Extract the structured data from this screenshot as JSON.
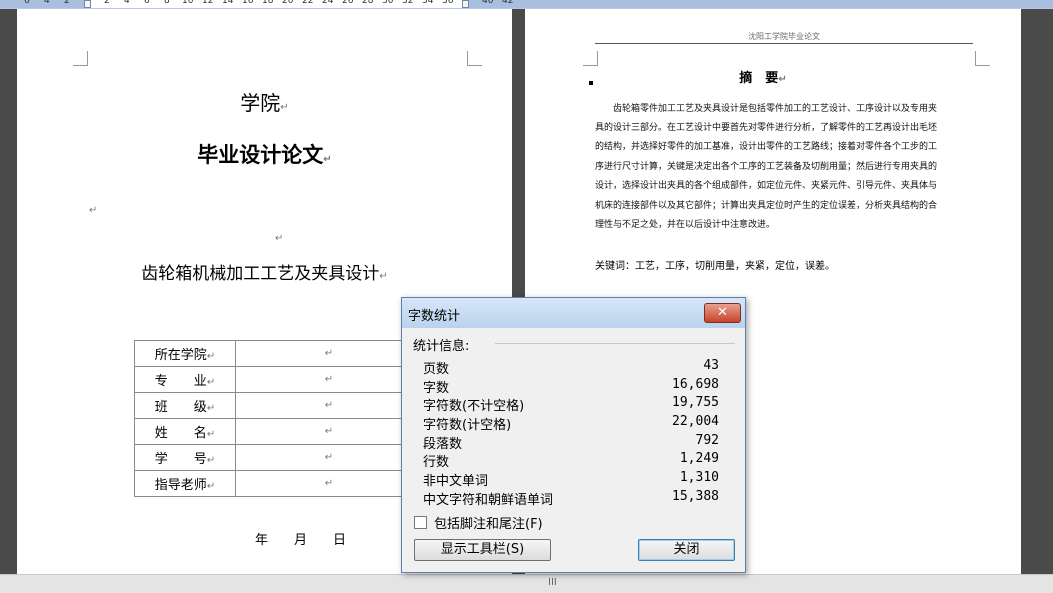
{
  "ruler": {
    "ticks": [
      "6",
      "4",
      "2",
      "2",
      "4",
      "6",
      "8",
      "10",
      "12",
      "14",
      "16",
      "18",
      "20",
      "22",
      "24",
      "26",
      "28",
      "30",
      "32",
      "34",
      "36",
      "40",
      "42"
    ]
  },
  "left_page": {
    "college": "学院",
    "thesis_title": "毕业设计论文",
    "topic": "齿轮箱机械加工工艺及夹具设计",
    "para_mark": "↵",
    "info_rows": [
      {
        "label": "所在学院",
        "value": ""
      },
      {
        "label": "专　　业",
        "value": ""
      },
      {
        "label": "班　　级",
        "value": ""
      },
      {
        "label": "姓　　名",
        "value": ""
      },
      {
        "label": "学　　号",
        "value": ""
      },
      {
        "label": "指导老师",
        "value": ""
      }
    ],
    "date_line": "年　　月　　日"
  },
  "right_page": {
    "header": "沈阳工学院毕业论文",
    "abstract_title": "摘　要",
    "abstract_lines": [
      "　　齿轮箱零件加工工艺及夹具设计是包括零件加工的工艺设计、工序设计以及专用夹",
      "具的设计三部分。在工艺设计中要首先对零件进行分析，了解零件的工艺再设计出毛坯",
      "的结构，并选择好零件的加工基准，设计出零件的工艺路线；接着对零件各个工步的工",
      "序进行尺寸计算，关键是决定出各个工序的工艺装备及切削用量；然后进行专用夹具的",
      "设计，选择设计出夹具的各个组成部件，如定位元件、夹紧元件、引导元件、夹具体与",
      "机床的连接部件以及其它部件；计算出夹具定位时产生的定位误差，分析夹具结构的合",
      "理性与不足之处，并在以后设计中注意改进。"
    ],
    "keywords": "关键词：工艺，工序，切削用量，夹紧，定位，误差。"
  },
  "dialog": {
    "title": "字数统计",
    "close_x": "✕",
    "section": "统计信息:",
    "stats": [
      {
        "label": "页数",
        "value": "43"
      },
      {
        "label": "字数",
        "value": "16,698"
      },
      {
        "label": "字符数(不计空格)",
        "value": "19,755"
      },
      {
        "label": "字符数(计空格)",
        "value": "22,004"
      },
      {
        "label": "段落数",
        "value": "792"
      },
      {
        "label": "行数",
        "value": "1,249"
      },
      {
        "label": "非中文单词",
        "value": "1,310"
      },
      {
        "label": "中文字符和朝鲜语单词",
        "value": "15,388"
      }
    ],
    "checkbox_label": "包括脚注和尾注(F)",
    "checkbox_checked": false,
    "toolbar_button": "显示工具栏(S)",
    "close_button": "关闭"
  },
  "statusbar": {
    "grip": "III"
  }
}
